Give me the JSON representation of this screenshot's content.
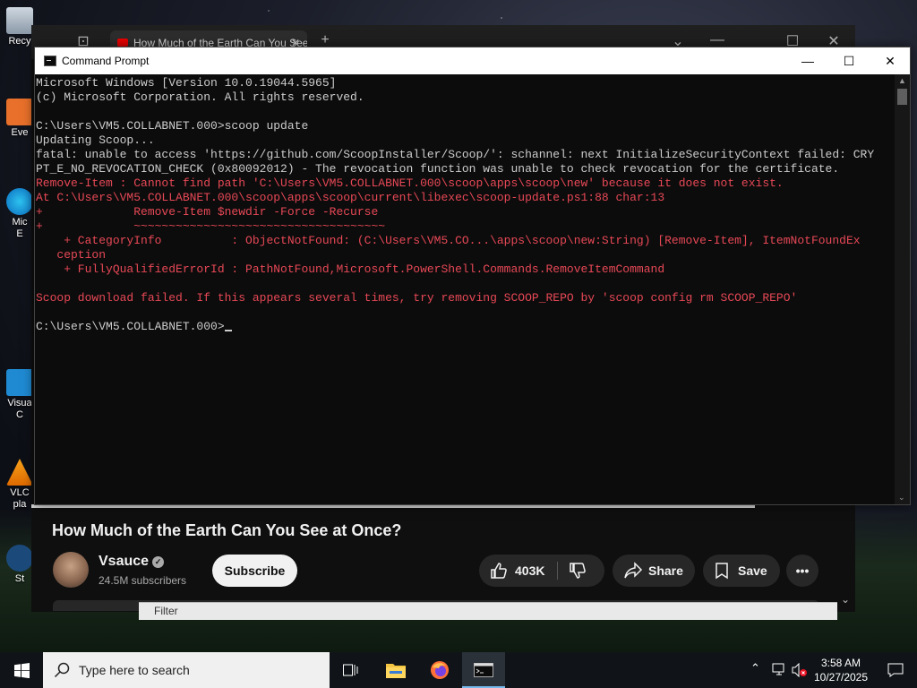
{
  "desktop": {
    "icons": [
      {
        "label": "Recy"
      },
      {
        "label": "Eve"
      },
      {
        "label": "Mic\nE"
      },
      {
        "label": "Visua\nC"
      },
      {
        "label": "VLC\npla"
      },
      {
        "label": "St"
      }
    ]
  },
  "browser": {
    "tab_title": "How Much of the Earth Can You See at Once?",
    "tab_close": "✕",
    "new_tab": "+",
    "video": {
      "title": "How Much of the Earth Can You See at Once?",
      "channel": "Vsauce",
      "subscribers": "24.5M subscribers",
      "subscribe_label": "Subscribe",
      "likes": "403K",
      "share_label": "Share",
      "save_label": "Save",
      "more_label": "•••"
    }
  },
  "filter": {
    "label": "Filter"
  },
  "cmd": {
    "title": "Command Prompt",
    "lines": [
      {
        "text": "Microsoft Windows [Version 10.0.19044.5965]",
        "cls": ""
      },
      {
        "text": "(c) Microsoft Corporation. All rights reserved.",
        "cls": ""
      },
      {
        "text": "",
        "cls": ""
      },
      {
        "text": "C:\\Users\\VM5.COLLABNET.000>scoop update",
        "cls": ""
      },
      {
        "text": "Updating Scoop...",
        "cls": ""
      },
      {
        "text": "fatal: unable to access 'https://github.com/ScoopInstaller/Scoop/': schannel: next InitializeSecurityContext failed: CRY",
        "cls": ""
      },
      {
        "text": "PT_E_NO_REVOCATION_CHECK (0x80092012) - The revocation function was unable to check revocation for the certificate.",
        "cls": ""
      },
      {
        "text": "Remove-Item : Cannot find path 'C:\\Users\\VM5.COLLABNET.000\\scoop\\apps\\scoop\\new' because it does not exist.",
        "cls": "red"
      },
      {
        "text": "At C:\\Users\\VM5.COLLABNET.000\\scoop\\apps\\scoop\\current\\libexec\\scoop-update.ps1:88 char:13",
        "cls": "red"
      },
      {
        "text": "+             Remove-Item $newdir -Force -Recurse",
        "cls": "red"
      },
      {
        "text": "+             ~~~~~~~~~~~~~~~~~~~~~~~~~~~~~~~~~~~~",
        "cls": "red"
      },
      {
        "text": "    + CategoryInfo          : ObjectNotFound: (C:\\Users\\VM5.CO...\\apps\\scoop\\new:String) [Remove-Item], ItemNotFoundEx",
        "cls": "red"
      },
      {
        "text": "   ception",
        "cls": "red"
      },
      {
        "text": "    + FullyQualifiedErrorId : PathNotFound,Microsoft.PowerShell.Commands.RemoveItemCommand",
        "cls": "red"
      },
      {
        "text": "",
        "cls": ""
      },
      {
        "text": "Scoop download failed. If this appears several times, try removing SCOOP_REPO by 'scoop config rm SCOOP_REPO'",
        "cls": "red"
      },
      {
        "text": "",
        "cls": ""
      },
      {
        "text": "C:\\Users\\VM5.COLLABNET.000>",
        "cls": "",
        "cursor": true
      }
    ]
  },
  "taskbar": {
    "search_placeholder": "Type here to search",
    "time": "3:58 AM",
    "date": "10/27/2025"
  },
  "colors": {
    "cmd_red": "#e74856",
    "cmd_text": "#cccccc",
    "taskbar_active": "#76b9ed"
  }
}
